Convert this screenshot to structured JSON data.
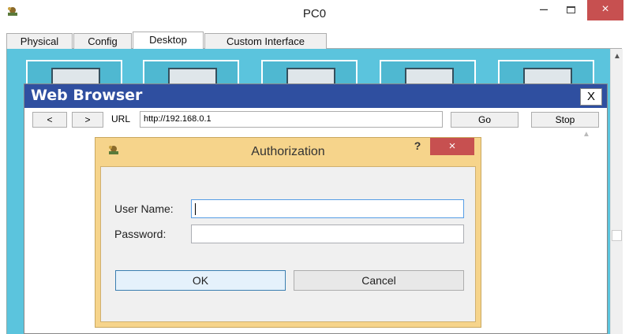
{
  "window": {
    "title": "PC0",
    "minimize": "–",
    "close": "×"
  },
  "tabs": [
    {
      "label": "Physical"
    },
    {
      "label": "Config"
    },
    {
      "label": "Desktop"
    },
    {
      "label": "Custom Interface"
    }
  ],
  "browser": {
    "title": "Web Browser",
    "close_label": "X",
    "back_label": "<",
    "forward_label": ">",
    "url_label": "URL",
    "url_value": "http://192.168.0.1",
    "go_label": "Go",
    "stop_label": "Stop"
  },
  "dialog": {
    "title": "Authorization",
    "help_label": "?",
    "close_label": "×",
    "username_label": "User Name:",
    "username_value": "",
    "password_label": "Password:",
    "password_value": "",
    "ok_label": "OK",
    "cancel_label": "Cancel"
  },
  "colors": {
    "desktop_bg": "#5bc4dd",
    "browser_title_bg": "#2f4fa0",
    "dialog_frame": "#f6d48b",
    "close_red": "#c75050"
  }
}
